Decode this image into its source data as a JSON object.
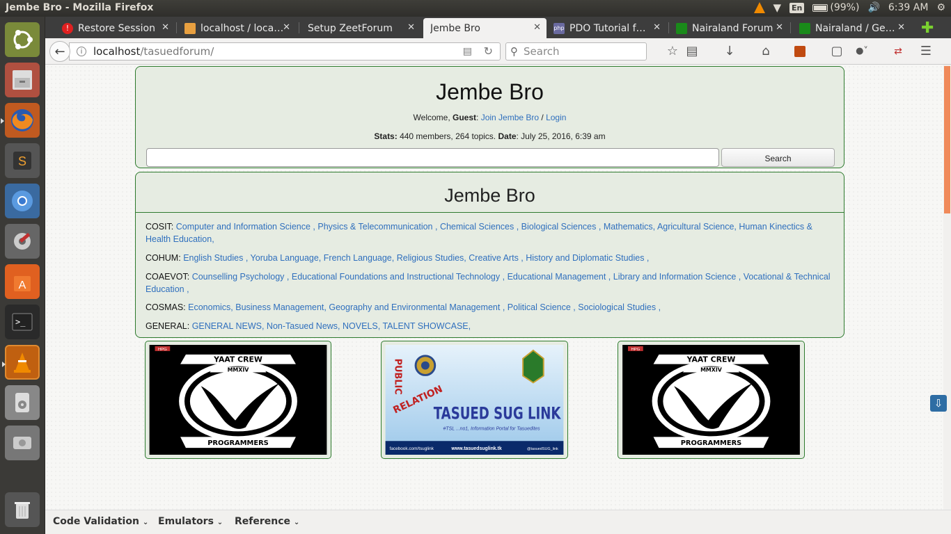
{
  "system_bar": {
    "window_title": "Jembe Bro - Mozilla Firefox",
    "keyboard": "En",
    "battery": "(99%)",
    "time": "6:39 AM"
  },
  "launcher": {
    "items": [
      "ubuntu-dash",
      "files",
      "firefox",
      "sublime-text",
      "chromium",
      "system-settings",
      "software-center",
      "terminal",
      "vlc",
      "rhythmbox",
      "disks",
      "trash"
    ]
  },
  "tabs": [
    {
      "label": "Restore Session",
      "icon": "alert-icon",
      "color": "#e02020"
    },
    {
      "label": "localhost / loca…",
      "icon": "phpmyadmin-icon",
      "color": "#e8a040"
    },
    {
      "label": "Setup ZeetForum",
      "icon": "none",
      "color": ""
    },
    {
      "label": "Jembe Bro",
      "icon": "none",
      "color": ""
    },
    {
      "label": "PDO Tutorial f…",
      "icon": "php-icon",
      "color": "#6a6aa0"
    },
    {
      "label": "Nairaland Forum",
      "icon": "nairaland-icon",
      "color": "#1a8a1a"
    },
    {
      "label": "Nairaland / Ge…",
      "icon": "nairaland-icon",
      "color": "#1a8a1a"
    }
  ],
  "navbar": {
    "url_host": "localhost",
    "url_path": "/tasuedforum/",
    "search_placeholder": "Search"
  },
  "header": {
    "title": "Jembe Bro",
    "welcome_prefix": "Welcome, ",
    "guest": "Guest",
    "colon": ": ",
    "join_link": "Join Jembe Bro",
    "sep": " / ",
    "login_link": "Login",
    "stats_label": "Stats:",
    "stats_text": " 440 members, 264 topics. ",
    "date_label": "Date",
    "date_text": ": July 25, 2016, 6:39 am",
    "search_button": "Search"
  },
  "categories": {
    "title": "Jembe Bro",
    "groups": [
      {
        "name": "COSIT:",
        "links": [
          "Computer and Information Science ,",
          "Physics & Telecommunication ,",
          "Chemical Sciences ,",
          "Biological Sciences ,",
          "Mathematics,",
          "Agricultural Science,",
          "Human Kinectics & Health Education,"
        ]
      },
      {
        "name": "COHUM:",
        "links": [
          "English Studies ,",
          "Yoruba Language,",
          "French Language,",
          "Religious Studies,",
          "Creative Arts ,",
          "History and Diplomatic Studies ,"
        ]
      },
      {
        "name": "COAEVOT:",
        "links": [
          "Counselling Psychology ,",
          "Educational Foundations and Instructional Technology ,",
          "Educational Management ,",
          "Library and Information Science ,",
          "Vocational & Technical Education ,"
        ]
      },
      {
        "name": "COSMAS:",
        "links": [
          "Economics,",
          "Business Management,",
          "Geography and Environmental Management ,",
          "Political Science ,",
          "Sociological Studies ,"
        ]
      },
      {
        "name": "GENERAL:",
        "links": [
          "GENERAL NEWS,",
          "Non-Tasued News,",
          "NOVELS,",
          "TALENT SHOWCASE,"
        ]
      }
    ]
  },
  "banners": [
    {
      "kind": "yaat-crew",
      "top": "YAAT CREW",
      "mid": "MMXIV",
      "bottom": "PROGRAMMERS",
      "tag": "HPG"
    },
    {
      "kind": "sug-link",
      "title": "TASUED SUG LINK",
      "tagline": "#TSL ...no1, Information Portal for Tasuedites",
      "word_pr": "PUBLIC",
      "word_rel": "RELATION",
      "fb": "facebook.com/tsuglink",
      "site": "www.tasuedsuglink.tk",
      "tw": "@tasuedSUG_link"
    },
    {
      "kind": "yaat-crew",
      "top": "YAAT CREW",
      "mid": "MMXIV",
      "bottom": "PROGRAMMERS",
      "tag": "HPG"
    }
  ],
  "devbar": {
    "items": [
      "Code Validation",
      "Emulators",
      "Reference"
    ]
  }
}
